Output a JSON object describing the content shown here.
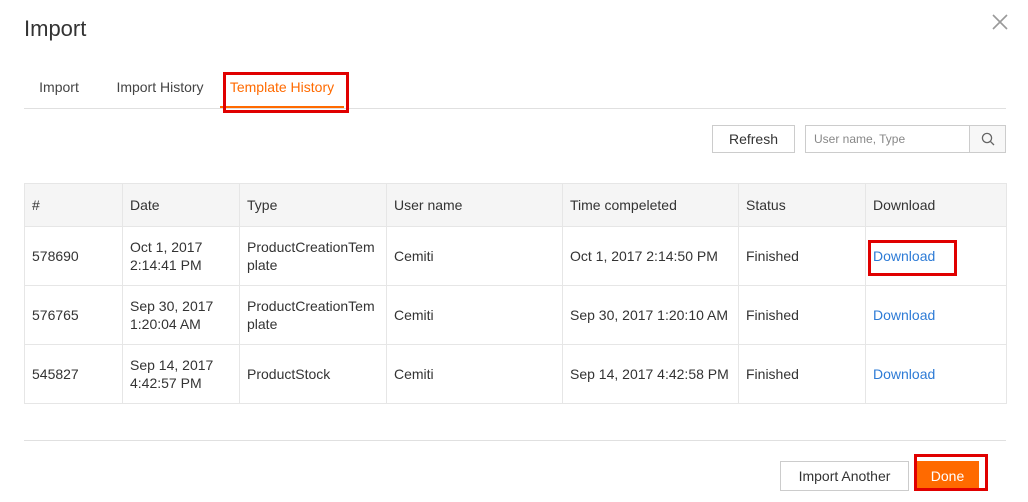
{
  "modal": {
    "title": "Import"
  },
  "tabs": [
    {
      "label": "Import"
    },
    {
      "label": "Import History"
    },
    {
      "label": "Template History"
    }
  ],
  "toolbar": {
    "refresh_label": "Refresh",
    "search_placeholder": "User name, Type",
    "search_icon": "search-icon"
  },
  "table": {
    "columns": [
      "#",
      "Date",
      "Type",
      "User name",
      "Time compeleted",
      "Status",
      "Download"
    ],
    "rows": [
      {
        "id": "578690",
        "date_line1": "Oct 1, 2017",
        "date_line2": "2:14:41 PM",
        "type_line1": "ProductCreationTem",
        "type_line2": "plate",
        "user": "Cemiti",
        "completed": "Oct 1, 2017 2:14:50 PM",
        "status": "Finished",
        "download": "Download"
      },
      {
        "id": "576765",
        "date_line1": "Sep 30, 2017",
        "date_line2": "1:20:04 AM",
        "type_line1": "ProductCreationTem",
        "type_line2": "plate",
        "user": "Cemiti",
        "completed": "Sep 30, 2017 1:20:10 AM",
        "status": "Finished",
        "download": "Download"
      },
      {
        "id": "545827",
        "date_line1": "Sep 14, 2017",
        "date_line2": "4:42:57 PM",
        "type_line1": "ProductStock",
        "type_line2": "",
        "user": "Cemiti",
        "completed": "Sep 14, 2017 4:42:58 PM",
        "status": "Finished",
        "download": "Download"
      }
    ]
  },
  "footer": {
    "import_another_label": "Import Another",
    "done_label": "Done"
  },
  "colors": {
    "accent": "#ff6a00",
    "link": "#2d7bd6",
    "highlight": "#e00000"
  },
  "icons": {
    "close": "close-icon",
    "search": "search-icon"
  }
}
